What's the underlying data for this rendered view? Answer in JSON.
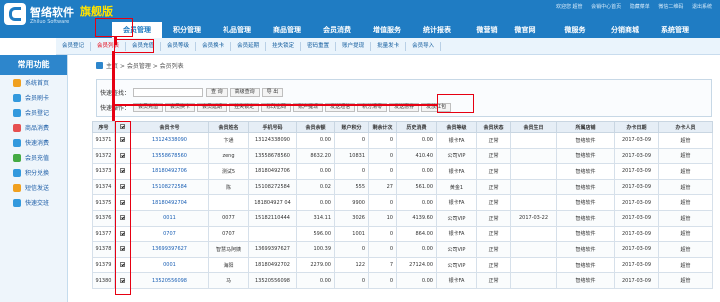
{
  "header": {
    "brand": "智络软件",
    "brand_sub": "Zhiluo Software",
    "edition": "旗舰版",
    "top_links": [
      "欢迎您 超管",
      "会销中心首页",
      "隐藏菜单",
      "微信二维码",
      "退出系统"
    ],
    "nav": [
      "会员管理",
      "积分管理",
      "礼品管理",
      "商品管理",
      "会员消费",
      "增值服务",
      "统计报表",
      "微营销",
      "微官网",
      "微服务",
      "分销商城",
      "系统管理"
    ]
  },
  "submenu": [
    "会员登记",
    "会员列表",
    "会员充值",
    "会员等级",
    "会员换卡",
    "会员延期",
    "挂失锁定",
    "密码重置",
    "账户提现",
    "批量发卡",
    "会员导入"
  ],
  "sidebar": {
    "title": "常用功能",
    "items": [
      {
        "label": "系统首页",
        "color": "#f0a020"
      },
      {
        "label": "会员刷卡",
        "color": "#3399dd"
      },
      {
        "label": "会员登记",
        "color": "#3399dd"
      },
      {
        "label": "商品消费",
        "color": "#e65050"
      },
      {
        "label": "快速消费",
        "color": "#3399dd"
      },
      {
        "label": "会员充值",
        "color": "#44aa44"
      },
      {
        "label": "积分兑换",
        "color": "#3399dd"
      },
      {
        "label": "短信发送",
        "color": "#f0a020"
      },
      {
        "label": "快速交班",
        "color": "#3399dd"
      }
    ]
  },
  "breadcrumb": "主页 > 会员管理 > 会员列表",
  "search": {
    "label": "快速查找：",
    "placeholder": "",
    "buttons": [
      "查 询",
      "高级查询",
      "导 出"
    ]
  },
  "actions": {
    "label": "快速操作：",
    "buttons": [
      "会员充值",
      "会员换卡",
      "会员延期",
      "挂失锁定",
      "修改密码",
      "账户提现",
      "发送短信",
      "积分清零",
      "发送惠券",
      "发放红包"
    ]
  },
  "table": {
    "columns": [
      "序号",
      "",
      "会员卡号",
      "会员姓名",
      "手机号码",
      "会员余额",
      "账户积分",
      "剩余计次",
      "历史消费",
      "会员等级",
      "会员状态",
      "会员生日",
      "所属店铺",
      "办卡日期",
      "办卡人员"
    ],
    "rows": [
      [
        "91371",
        "13124338090",
        "卞通",
        "13124338090",
        "0.00",
        "0",
        "0",
        "0.00",
        "银卡FA",
        "正常",
        "",
        "智络软件",
        "2017-03-09",
        "超管"
      ],
      [
        "91372",
        "13558678560",
        "zeng",
        "13558678560",
        "8632.20",
        "10831",
        "0",
        "410.40",
        "公司VIP",
        "正常",
        "",
        "智络软件",
        "2017-03-09",
        "超管"
      ],
      [
        "91373",
        "18180492706",
        "测试5",
        "18180492706",
        "0.00",
        "0",
        "0",
        "0.00",
        "银卡FA",
        "正常",
        "",
        "智络软件",
        "2017-03-09",
        "超管"
      ],
      [
        "91374",
        "15108272584",
        "陈",
        "15108272584",
        "0.02",
        "555",
        "27",
        "561.00",
        "黄金1",
        "正常",
        "",
        "智络软件",
        "2017-03-09",
        "超管"
      ],
      [
        "91375",
        "18180492704",
        "",
        "181804927 04",
        "0.00",
        "9900",
        "0",
        "0.00",
        "银卡FA",
        "正常",
        "",
        "智络软件",
        "2017-03-09",
        "超管"
      ],
      [
        "91376",
        "0011",
        "0077",
        "15182110444",
        "314.11",
        "3026",
        "10",
        "4139.60",
        "公司VIP",
        "正常",
        "2017-03-22",
        "智络软件",
        "2017-03-09",
        "超管"
      ],
      [
        "91377",
        "0707",
        "0707",
        "",
        "596.00",
        "1001",
        "0",
        "864.00",
        "银卡FA",
        "正常",
        "",
        "智络软件",
        "2017-03-09",
        "超管"
      ],
      [
        "91378",
        "13699397627",
        "智慧马阿姨",
        "13699397627",
        "100.39",
        "0",
        "0",
        "0.00",
        "公司VIP",
        "正常",
        "",
        "智络软件",
        "2017-03-09",
        "超管"
      ],
      [
        "91379",
        "0001",
        "海阳",
        "18180492702",
        "2279.00",
        "122",
        "7",
        "27124.00",
        "公司VIP",
        "正常",
        "",
        "智络软件",
        "2017-03-09",
        "超管"
      ],
      [
        "91380",
        "13520556098",
        "马",
        "13520556098",
        "0.00",
        "0",
        "0",
        "0.00",
        "银卡FA",
        "正常",
        "",
        "智络软件",
        "2017-03-09",
        "超管"
      ]
    ]
  },
  "colors": {
    "header": "#1f7cc3",
    "highlight": "#e60012",
    "link": "#1a5fb4"
  }
}
